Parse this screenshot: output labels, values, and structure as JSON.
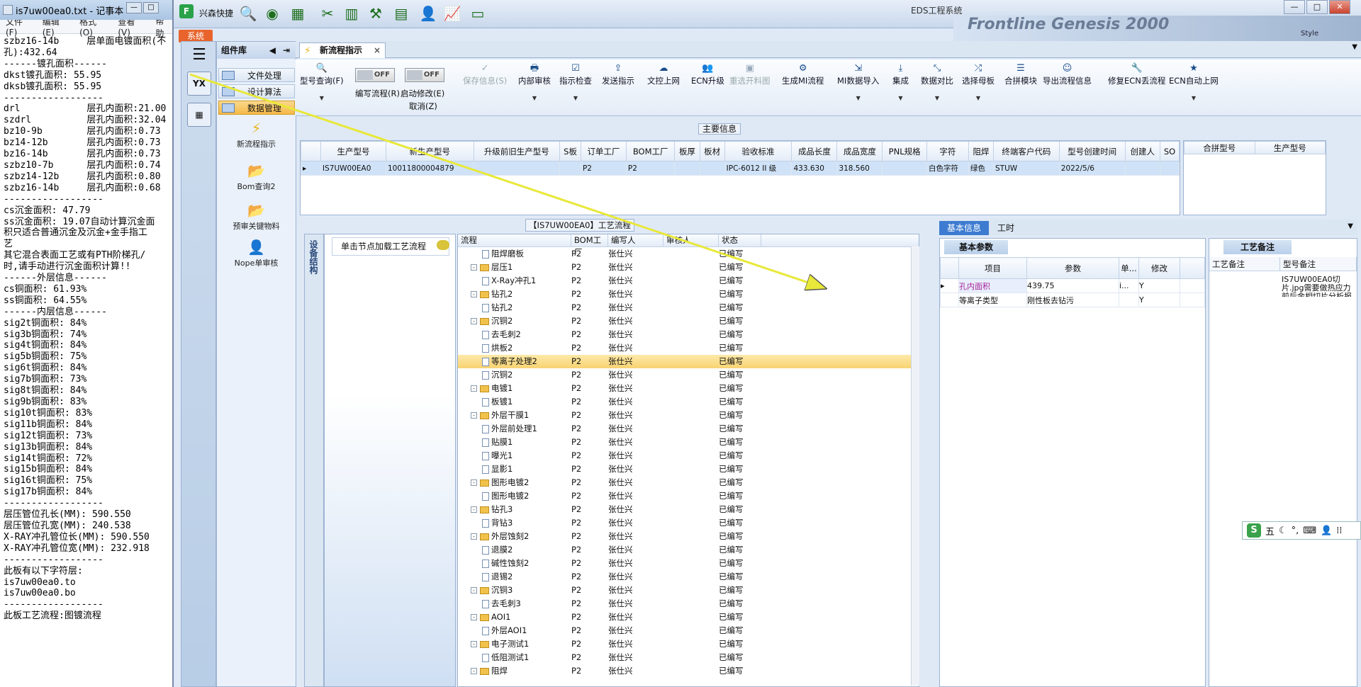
{
  "notepad": {
    "title": "is7uw00ea0.txt - 记事本",
    "menu": [
      "文件(F)",
      "编辑(E)",
      "格式(O)",
      "查看(V)",
      "帮助"
    ],
    "lines": [
      "szbz16-14b     层单面电镀面积(不",
      "孔):432.64",
      "",
      "------镀孔面积------",
      "dkst镀孔面积: 55.95",
      "dksb镀孔面积: 55.95",
      "",
      "------------------",
      "drl            层孔内面积:21.00",
      "szdrl          层孔内面积:32.04",
      "bz10-9b        层孔内面积:0.73",
      "bz14-12b       层孔内面积:0.73",
      "bz16-14b       层孔内面积:0.73",
      "szbz10-7b      层孔内面积:0.74",
      "szbz14-12b     层孔内面积:0.80",
      "szbz16-14b     层孔内面积:0.68",
      "",
      "------------------",
      "cs沉金面积: 47.79",
      "ss沉金面积: 19.07自动计算沉金面",
      "积只适合普通沉金及沉金+金手指工",
      "艺",
      "其它混合表面工艺或有PTH阶梯孔/",
      "时,请手动进行沉金面积计算!!",
      "------外层信息------",
      "cs铜面积: 61.93%",
      "ss铜面积: 64.55%",
      "------内层信息------",
      "sig2t铜面积: 84%",
      "sig3b铜面积: 74%",
      "sig4t铜面积: 84%",
      "sig5b铜面积: 75%",
      "sig6t铜面积: 84%",
      "sig7b铜面积: 73%",
      "sig8t铜面积: 84%",
      "sig9b铜面积: 83%",
      "sig10t铜面积: 83%",
      "sig11b铜面积: 84%",
      "sig12t铜面积: 73%",
      "sig13b铜面积: 84%",
      "sig14t铜面积: 72%",
      "sig15b铜面积: 84%",
      "sig16t铜面积: 75%",
      "sig17b铜面积: 84%",
      "",
      "------------------",
      "层压管位孔长(MM): 590.550",
      "层压管位孔宽(MM): 240.538",
      "",
      "X-RAY冲孔管位长(MM): 590.550",
      "X-RAY冲孔管位宽(MM): 232.918",
      "",
      "------------------",
      "此板有以下字符层:",
      "is7uw00ea0.to",
      "is7uw00ea0.bo",
      "",
      "------------------",
      "此板工艺流程:图镀流程"
    ]
  },
  "app": {
    "title": "EDS工程系统",
    "quick_label": "兴森快捷",
    "system_btn": "系统",
    "bg_text": "Frontline Genesis 2000",
    "style_label": "Style"
  },
  "sidebar": {
    "header": "组件库",
    "menus": [
      "文件处理",
      "设计算法",
      "数据管理"
    ],
    "nav": [
      "新流程指示",
      "Bom查询2",
      "预审关键物料",
      "Nope单审核"
    ]
  },
  "tab": {
    "label": "新流程指示"
  },
  "ribbon": {
    "query": "型号查询(F)",
    "toggle1": "OFF",
    "toggle1_label": "编写流程(R)",
    "toggle2": "OFF",
    "toggle2_label": "启动修改(E)",
    "cancel": "取消(Z)",
    "save": "保存信息(S)",
    "buttons": [
      "内部审核",
      "指示检查",
      "发送指示",
      "文控上网",
      "ECN升级",
      "重选开料图",
      "生成MI流程",
      "MI数据导入",
      "集成",
      "数据对比",
      "选择母板",
      "合拼模块",
      "导出流程信息",
      "修复ECN丢流程",
      "ECN自动上网"
    ]
  },
  "main_info": {
    "label": "主要信息",
    "columns": [
      "生产型号",
      "新生产型号",
      "升级前旧生产型号",
      "S板",
      "订单工厂",
      "BOM工厂",
      "板厚",
      "板材",
      "验收标准",
      "成品长度",
      "成品宽度",
      "PNL规格",
      "字符",
      "阻焊",
      "终端客户代码",
      "型号创建时间",
      "创建人",
      "SO"
    ],
    "row": [
      "IS7UW00EA0",
      "10011800004879",
      "",
      "",
      "P2",
      "P2",
      "",
      "",
      "IPC-6012 II 级",
      "433.630",
      "318.560",
      "",
      "白色字符",
      "绿色",
      "STUW",
      "2022/5/6",
      "",
      ""
    ],
    "side_columns": [
      "合拼型号",
      "生产型号"
    ]
  },
  "flow": {
    "device_struct": "设备结构",
    "hint": "单击节点加载工艺流程",
    "title": "【IS7UW00EA0】工艺流程",
    "columns": [
      "流程",
      "BOM工厂",
      "编写人",
      "审核人",
      "状态"
    ],
    "rows": [
      {
        "name": "阻焊磨板",
        "lvl": 2,
        "type": "doc",
        "bom": "P2",
        "by": "张仕兴",
        "st": "已编写"
      },
      {
        "name": "层压1",
        "lvl": 1,
        "type": "folder",
        "bom": "P2",
        "by": "张仕兴",
        "st": "已编写"
      },
      {
        "name": "X-Ray冲孔1",
        "lvl": 2,
        "type": "doc",
        "bom": "P2",
        "by": "张仕兴",
        "st": "已编写"
      },
      {
        "name": "钻孔2",
        "lvl": 1,
        "type": "folder",
        "bom": "P2",
        "by": "张仕兴",
        "st": "已编写"
      },
      {
        "name": "钻孔2",
        "lvl": 2,
        "type": "doc",
        "bom": "P2",
        "by": "张仕兴",
        "st": "已编写"
      },
      {
        "name": "沉铜2",
        "lvl": 1,
        "type": "folder",
        "bom": "P2",
        "by": "张仕兴",
        "st": "已编写"
      },
      {
        "name": "去毛刺2",
        "lvl": 2,
        "type": "doc",
        "bom": "P2",
        "by": "张仕兴",
        "st": "已编写"
      },
      {
        "name": "烘板2",
        "lvl": 2,
        "type": "doc",
        "bom": "P2",
        "by": "张仕兴",
        "st": "已编写"
      },
      {
        "name": "等离子处理2",
        "lvl": 2,
        "type": "doc",
        "bom": "P2",
        "by": "张仕兴",
        "st": "已编写",
        "hl": true
      },
      {
        "name": "沉铜2",
        "lvl": 2,
        "type": "doc",
        "bom": "P2",
        "by": "张仕兴",
        "st": "已编写"
      },
      {
        "name": "电镀1",
        "lvl": 1,
        "type": "folder",
        "bom": "P2",
        "by": "张仕兴",
        "st": "已编写"
      },
      {
        "name": "板镀1",
        "lvl": 2,
        "type": "doc",
        "bom": "P2",
        "by": "张仕兴",
        "st": "已编写"
      },
      {
        "name": "外层干膜1",
        "lvl": 1,
        "type": "folder",
        "bom": "P2",
        "by": "张仕兴",
        "st": "已编写"
      },
      {
        "name": "外层前处理1",
        "lvl": 2,
        "type": "doc",
        "bom": "P2",
        "by": "张仕兴",
        "st": "已编写"
      },
      {
        "name": "贴膜1",
        "lvl": 2,
        "type": "doc",
        "bom": "P2",
        "by": "张仕兴",
        "st": "已编写"
      },
      {
        "name": "曝光1",
        "lvl": 2,
        "type": "doc",
        "bom": "P2",
        "by": "张仕兴",
        "st": "已编写"
      },
      {
        "name": "显影1",
        "lvl": 2,
        "type": "doc",
        "bom": "P2",
        "by": "张仕兴",
        "st": "已编写"
      },
      {
        "name": "图形电镀2",
        "lvl": 1,
        "type": "folder",
        "bom": "P2",
        "by": "张仕兴",
        "st": "已编写"
      },
      {
        "name": "图形电镀2",
        "lvl": 2,
        "type": "doc",
        "bom": "P2",
        "by": "张仕兴",
        "st": "已编写"
      },
      {
        "name": "钻孔3",
        "lvl": 1,
        "type": "folder",
        "bom": "P2",
        "by": "张仕兴",
        "st": "已编写"
      },
      {
        "name": "背钻3",
        "lvl": 2,
        "type": "doc",
        "bom": "P2",
        "by": "张仕兴",
        "st": "已编写"
      },
      {
        "name": "外层蚀刻2",
        "lvl": 1,
        "type": "folder",
        "bom": "P2",
        "by": "张仕兴",
        "st": "已编写"
      },
      {
        "name": "退膜2",
        "lvl": 2,
        "type": "doc",
        "bom": "P2",
        "by": "张仕兴",
        "st": "已编写"
      },
      {
        "name": "碱性蚀刻2",
        "lvl": 2,
        "type": "doc",
        "bom": "P2",
        "by": "张仕兴",
        "st": "已编写"
      },
      {
        "name": "退锡2",
        "lvl": 2,
        "type": "doc",
        "bom": "P2",
        "by": "张仕兴",
        "st": "已编写"
      },
      {
        "name": "沉铜3",
        "lvl": 1,
        "type": "folder",
        "bom": "P2",
        "by": "张仕兴",
        "st": "已编写"
      },
      {
        "name": "去毛刺3",
        "lvl": 2,
        "type": "doc",
        "bom": "P2",
        "by": "张仕兴",
        "st": "已编写"
      },
      {
        "name": "AOI1",
        "lvl": 1,
        "type": "folder",
        "bom": "P2",
        "by": "张仕兴",
        "st": "已编写"
      },
      {
        "name": "外层AOI1",
        "lvl": 2,
        "type": "doc",
        "bom": "P2",
        "by": "张仕兴",
        "st": "已编写"
      },
      {
        "name": "电子测试1",
        "lvl": 1,
        "type": "folder",
        "bom": "P2",
        "by": "张仕兴",
        "st": "已编写"
      },
      {
        "name": "低阻测试1",
        "lvl": 2,
        "type": "doc",
        "bom": "P2",
        "by": "张仕兴",
        "st": "已编写"
      },
      {
        "name": "阻焊",
        "lvl": 1,
        "type": "folder",
        "bom": "P2",
        "by": "张仕兴",
        "st": "已编写"
      }
    ]
  },
  "basic": {
    "tab1": "基本信息",
    "tab2": "工时",
    "title": "基本参数",
    "columns": [
      "项目",
      "参数",
      "单...",
      "修改"
    ],
    "rows": [
      {
        "item": "孔内面积",
        "param": "439.75",
        "unit": "i...",
        "mod": "Y"
      },
      {
        "item": "等离子类型",
        "param": "刚性板去钻污",
        "unit": "",
        "mod": "Y"
      }
    ]
  },
  "craft": {
    "title": "工艺备注",
    "cols": [
      "工艺备注",
      "型号备注"
    ],
    "note": "IS7UW00EA0切片.jpg需要做热应力前后金相切片分析报告"
  },
  "ime": {
    "label": "五"
  }
}
